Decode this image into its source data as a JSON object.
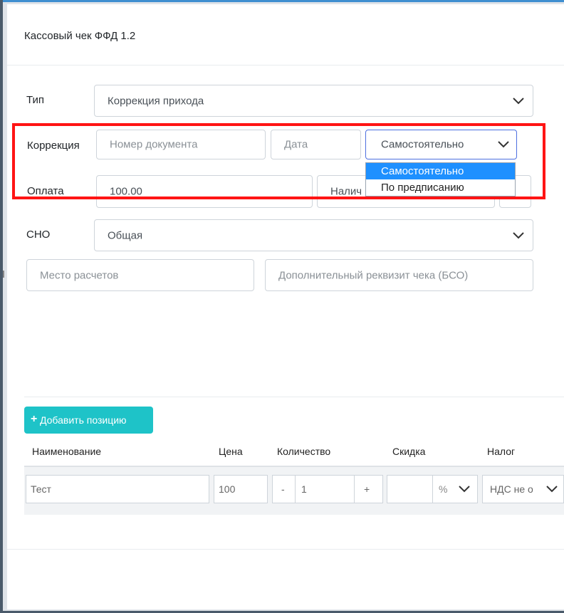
{
  "modal": {
    "title": "Кассовый чек ФФД 1.2"
  },
  "form": {
    "type": {
      "label": "Тип",
      "value": "Коррекция прихода"
    },
    "correction": {
      "label": "Коррекция",
      "doc_number_placeholder": "Номер документа",
      "date_placeholder": "Дата",
      "kind_value": "Самостоятельно",
      "kind_options": [
        "Самостоятельно",
        "По предписанию"
      ]
    },
    "payment": {
      "label": "Оплата",
      "amount": "100.00",
      "method_value": "Налич"
    },
    "tax_system": {
      "label": "СНО",
      "value": "Общая"
    },
    "place_placeholder": "Место расчетов",
    "extra_placeholder": "Дополнительный реквизит чека (БСО)"
  },
  "positions": {
    "add_button_label": "Добавить позицию",
    "headers": {
      "name": "Наименование",
      "price": "Цена",
      "qty": "Количество",
      "discount": "Скидка",
      "tax": "Налог"
    },
    "row": {
      "name": "Тест",
      "price": "100",
      "minus": "-",
      "qty": "1",
      "plus": "+",
      "discount": "",
      "discount_unit": "%",
      "tax": "НДС не о"
    }
  }
}
